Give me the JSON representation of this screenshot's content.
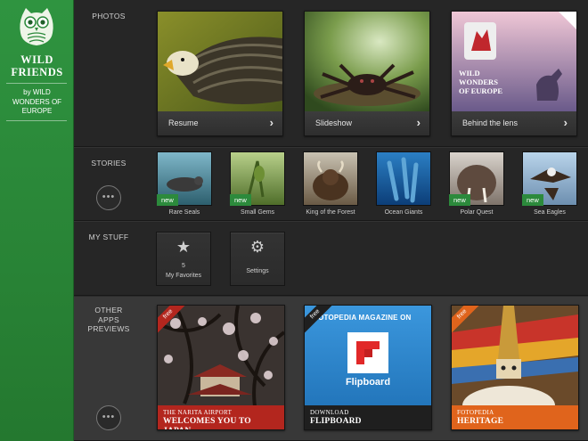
{
  "sidebar": {
    "title_line1": "WILD",
    "title_line2": "FRIENDS",
    "subtitle_line1": "by WILD",
    "subtitle_line2": "WONDERS OF",
    "subtitle_line3": "EUROPE",
    "brand_color": "#2c8a3c"
  },
  "photos": {
    "label": "PHOTOS",
    "cards": [
      {
        "label": "Resume"
      },
      {
        "label": "Slideshow"
      },
      {
        "label": "Behind the lens",
        "book_line1": "WILD",
        "book_line2": "WONDERS",
        "book_line3": "OF EUROPE"
      }
    ]
  },
  "stories": {
    "label": "STORIES",
    "badge": "new",
    "items": [
      {
        "caption": "Rare Seals",
        "new": true
      },
      {
        "caption": "Small Gems",
        "new": true
      },
      {
        "caption": "King of the Forest",
        "new": false
      },
      {
        "caption": "Ocean Giants",
        "new": false
      },
      {
        "caption": "Polar Quest",
        "new": true
      },
      {
        "caption": "Sea Eagles",
        "new": true
      }
    ],
    "more_icon": "more-dots-icon"
  },
  "mystuff": {
    "label": "MY STUFF",
    "favorites_count": "5",
    "favorites_label": "My Favorites",
    "settings_label": "Settings"
  },
  "other": {
    "label_line1": "OTHER",
    "label_line2": "APPS",
    "label_line3": "PREVIEWS",
    "ribbon": "free",
    "apps": [
      {
        "line1": "THE NARITA AIRPORT",
        "line2": "WELCOMES YOU TO JAPAN",
        "color": "#b3261e"
      },
      {
        "header": "FOTOPEDIA MAGAZINE ON",
        "logo_text": "Flipboard",
        "line1": "DOWNLOAD",
        "line2": "FLIPBOARD",
        "color": "#1f1f1f"
      },
      {
        "line1": "FOTOPEDIA",
        "line2": "HERITAGE",
        "color": "#e0641c"
      }
    ]
  }
}
